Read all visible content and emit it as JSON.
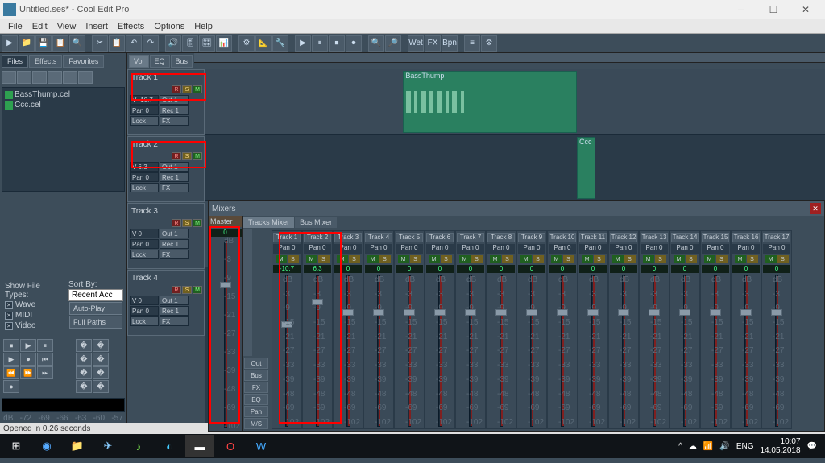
{
  "window": {
    "title": "Untitled.ses* - Cool Edit Pro"
  },
  "menu": [
    "File",
    "Edit",
    "View",
    "Insert",
    "Effects",
    "Options",
    "Help"
  ],
  "left": {
    "tabs": [
      "Files",
      "Effects",
      "Favorites"
    ],
    "files": [
      "BassThump.cel",
      "Ccc.cel"
    ],
    "show_label": "Show File Types:",
    "types": [
      "Wave",
      "MIDI",
      "Video"
    ],
    "sort_label": "Sort By:",
    "sort_value": "Recent Acc",
    "autoplay": "Auto-Play",
    "fullpaths": "Full Paths",
    "meter_ticks": [
      "dB",
      "-72",
      "-69",
      "-66",
      "-63",
      "-60",
      "-57"
    ]
  },
  "view_tabs": [
    "Vol",
    "EQ",
    "Bus"
  ],
  "tracks": [
    {
      "name": "Track 1",
      "vol": "V -10.7",
      "pan": "Pan 0",
      "out": "Out 1",
      "rec": "Rec 1",
      "lock": "Lock",
      "fx": "FX"
    },
    {
      "name": "Track 2",
      "vol": "V 6.3",
      "pan": "Pan 0",
      "out": "Out 1",
      "rec": "Rec 1",
      "lock": "Lock",
      "fx": "FX"
    },
    {
      "name": "Track 3",
      "vol": "V 0",
      "pan": "Pan 0",
      "out": "Out 1",
      "rec": "Rec 1",
      "lock": "Lock",
      "fx": "FX"
    },
    {
      "name": "Track 4",
      "vol": "V 0",
      "pan": "Pan 0",
      "out": "Out 1",
      "rec": "Rec 1",
      "lock": "Lock",
      "fx": "FX"
    }
  ],
  "clips": [
    {
      "name": "BassThump"
    },
    {
      "name": "Ccc"
    }
  ],
  "mixer": {
    "title": "Mixers",
    "master": "Master",
    "tabs": [
      "Tracks Mixer",
      "Bus Mixer"
    ],
    "side_btns": [
      "Out",
      "Bus",
      "FX",
      "EQ",
      "Pan",
      "M/S"
    ],
    "pan_label": "Pan",
    "scale": [
      "dB",
      "-3",
      "-9",
      "-15",
      "-21",
      "-27",
      "-33",
      "-39",
      "-48",
      "-69",
      "-102"
    ],
    "channels": [
      {
        "name": "Track 1",
        "pan": "Pan 0",
        "val": "-10.7",
        "knob": 30
      },
      {
        "name": "Track 2",
        "pan": "Pan 0",
        "val": "6.3",
        "knob": 15
      },
      {
        "name": "Track 3",
        "pan": "Pan 0",
        "val": "0",
        "knob": 22
      },
      {
        "name": "Track 4",
        "pan": "Pan 0",
        "val": "0",
        "knob": 22
      },
      {
        "name": "Track 5",
        "pan": "Pan 0",
        "val": "0",
        "knob": 22
      },
      {
        "name": "Track 6",
        "pan": "Pan 0",
        "val": "0",
        "knob": 22
      },
      {
        "name": "Track 7",
        "pan": "Pan 0",
        "val": "0",
        "knob": 22
      },
      {
        "name": "Track 8",
        "pan": "Pan 0",
        "val": "0",
        "knob": 22
      },
      {
        "name": "Track 9",
        "pan": "Pan 0",
        "val": "0",
        "knob": 22
      },
      {
        "name": "Track 10",
        "pan": "Pan 0",
        "val": "0",
        "knob": 22
      },
      {
        "name": "Track 11",
        "pan": "Pan 0",
        "val": "0",
        "knob": 22
      },
      {
        "name": "Track 12",
        "pan": "Pan 0",
        "val": "0",
        "knob": 22
      },
      {
        "name": "Track 13",
        "pan": "Pan 0",
        "val": "0",
        "knob": 22
      },
      {
        "name": "Track 14",
        "pan": "Pan 0",
        "val": "0",
        "knob": 22
      },
      {
        "name": "Track 15",
        "pan": "Pan 0",
        "val": "0",
        "knob": 22
      },
      {
        "name": "Track 16",
        "pan": "Pan 0",
        "val": "0",
        "knob": 22
      },
      {
        "name": "Track 17",
        "pan": "Pan 0",
        "val": "0",
        "knob": 22
      }
    ]
  },
  "status": "Opened in 0.26 seconds",
  "taskbar": {
    "lang": "ENG",
    "time": "10:07",
    "date": "14.05.2018"
  }
}
